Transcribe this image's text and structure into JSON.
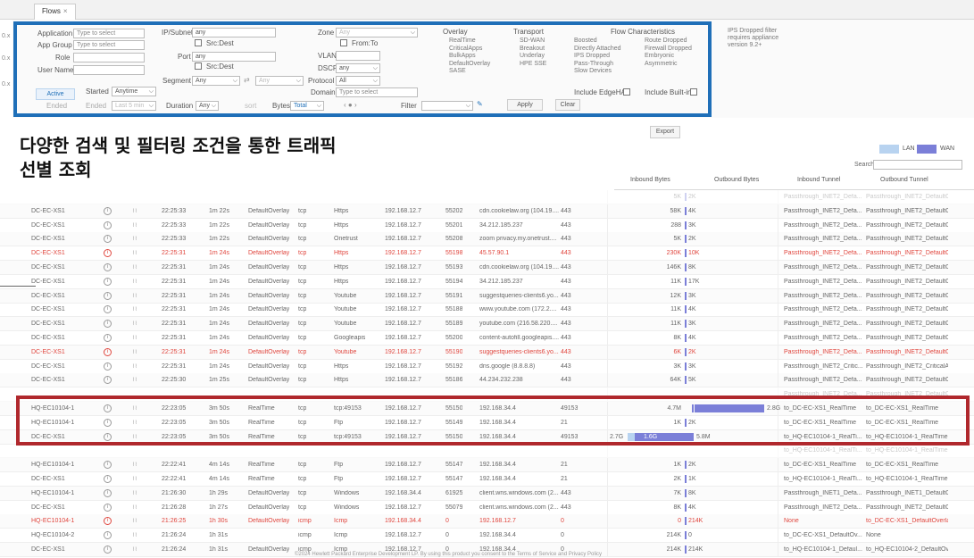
{
  "window": {
    "tab_label": "Flows",
    "tab_close": "×"
  },
  "left_ticks": [
    "0.x",
    "0.x",
    "0.x"
  ],
  "colors": {
    "lan": "#b8d3f0",
    "wan": "#7b7fd8",
    "frame_blue": "#1f6fb8",
    "frame_red": "#b0282d",
    "dropped_red": "#e0463e"
  },
  "filters": {
    "application_label": "Application",
    "application_placeholder": "Type to select",
    "app_group_label": "App Group",
    "app_group_placeholder": "Type to select",
    "role_label": "Role",
    "user_name_label": "User Name",
    "ip_subnet_label": "IP/Subnet",
    "ip_subnet_value": "any",
    "src_dest_1": "Src:Dest",
    "port_label": "Port",
    "port_value": "any",
    "src_dest_2": "Src:Dest",
    "segment_label": "Segment",
    "segment_value": "Any",
    "segment_value_2": "Any",
    "zone_label": "Zone",
    "zone_value": "Any",
    "from_to": "From:To",
    "vlan_label": "VLAN",
    "dscp_label": "DSCP",
    "dscp_value": "any",
    "protocol_label": "Protocol",
    "protocol_value": "All",
    "domain_label": "Domain",
    "domain_placeholder": "Type to select",
    "active_button": "Active",
    "ended_label": "Ended",
    "started_label": "Started",
    "started_value": "Anytime",
    "ended2_label": "Ended",
    "ended2_value": "Last 5 min",
    "duration_label": "Duration",
    "duration_value": "Any",
    "sort_label": "sort",
    "bytes_label": "Bytes",
    "bytes_value": "Total",
    "filter_label": "Filter",
    "apply_button": "Apply",
    "clear_button": "Clear"
  },
  "overlay": {
    "title": "Overlay",
    "options": [
      "RealTime",
      "CriticalApps",
      "BulkApps",
      "DefaultOverlay",
      "SASE"
    ]
  },
  "transport": {
    "title": "Transport",
    "options": [
      "SD-WAN",
      "Breakout",
      "Underlay",
      "HPE SSE"
    ]
  },
  "flow_characteristics": {
    "title": "Flow Characteristics",
    "col1": [
      "Boosted",
      "Directly Attached",
      "IPS Dropped",
      "Pass-Through",
      "Slow Devices"
    ],
    "col2": [
      "Route Dropped",
      "Firewall Dropped",
      "Embryonic",
      "Asymmetric"
    ],
    "include_edgeha": "Include EdgeHA",
    "include_builtin": "Include Built-in"
  },
  "ips_note": {
    "line1": "IPS Dropped filter",
    "line2": "requires appliance",
    "line3": "version 9.2+"
  },
  "heading": {
    "line1": "다양한 검색 및 필터링 조건을 통한 트래픽",
    "line2": "선별 조회"
  },
  "toolbar": {
    "export": "Export",
    "lan": "LAN",
    "wan": "WAN",
    "search_label": "Search"
  },
  "columns": {
    "inbound_bytes": "Inbound Bytes",
    "outbound_bytes": "Outbound Bytes",
    "inbound_tunnel": "Inbound Tunnel",
    "outbound_tunnel": "Outbound Tunnel"
  },
  "rows": [
    {
      "in": "5K",
      "out": "2K",
      "it": "Passthrough_INET2_Defa...",
      "ot": "Passthrough_INET2_DefaultOv...",
      "cut": true
    },
    {
      "dev": "DC-EC-XS1",
      "time": "22:25:33",
      "dur": "1m 22s",
      "ov": "DefaultOverlay",
      "proto": "tcp",
      "app": "Https",
      "src": "192.168.12.7",
      "sport": "55202",
      "dst": "cdn.cookielaw.org (104.19....",
      "dport": "443",
      "in": "58K",
      "out": "4K",
      "it": "Passthrough_INET2_Defa...",
      "ot": "Passthrough_INET2_DefaultOv..."
    },
    {
      "dev": "DC-EC-XS1",
      "time": "22:25:33",
      "dur": "1m 22s",
      "ov": "DefaultOverlay",
      "proto": "tcp",
      "app": "Https",
      "src": "192.168.12.7",
      "sport": "55201",
      "dst": "34.212.185.237",
      "dport": "443",
      "in": "288",
      "out": "3K",
      "it": "Passthrough_INET2_Defa...",
      "ot": "Passthrough_INET2_DefaultOv..."
    },
    {
      "dev": "DC-EC-XS1",
      "time": "22:25:33",
      "dur": "1m 22s",
      "ov": "DefaultOverlay",
      "proto": "tcp",
      "app": "Onetrust",
      "src": "192.168.12.7",
      "sport": "55208",
      "dst": "zoom privacy.my.onetrust....",
      "dport": "443",
      "in": "5K",
      "out": "2K",
      "it": "Passthrough_INET2_Defa...",
      "ot": "Passthrough_INET2_DefaultOv..."
    },
    {
      "dev": "DC-EC-XS1",
      "time": "22:25:31",
      "dur": "1m 24s",
      "ov": "DefaultOverlay",
      "proto": "tcp",
      "app": "Https",
      "src": "192.168.12.7",
      "sport": "55198",
      "dst": "45.57.90.1",
      "dport": "443",
      "in": "230K",
      "out": "10K",
      "it": "Passthrough_INET2_Defa...",
      "ot": "Passthrough_INET2_DefaultOv...",
      "red": true
    },
    {
      "dev": "DC-EC-XS1",
      "time": "22:25:31",
      "dur": "1m 24s",
      "ov": "DefaultOverlay",
      "proto": "tcp",
      "app": "Https",
      "src": "192.168.12.7",
      "sport": "55193",
      "dst": "cdn.cookielaw.org (104.19....",
      "dport": "443",
      "in": "146K",
      "out": "8K",
      "it": "Passthrough_INET2_Defa...",
      "ot": "Passthrough_INET2_DefaultOv..."
    },
    {
      "dev": "DC-EC-XS1",
      "time": "22:25:31",
      "dur": "1m 24s",
      "ov": "DefaultOverlay",
      "proto": "tcp",
      "app": "Https",
      "src": "192.168.12.7",
      "sport": "55194",
      "dst": "34.212.185.237",
      "dport": "443",
      "in": "11K",
      "out": "17K",
      "it": "Passthrough_INET2_Defa...",
      "ot": "Passthrough_INET2_DefaultOv..."
    },
    {
      "dev": "DC-EC-XS1",
      "time": "22:25:31",
      "dur": "1m 24s",
      "ov": "DefaultOverlay",
      "proto": "tcp",
      "app": "Youtube",
      "src": "192.168.12.7",
      "sport": "55191",
      "dst": "suggestqueries-clients6.yo...",
      "dport": "443",
      "in": "12K",
      "out": "3K",
      "it": "Passthrough_INET2_Defa...",
      "ot": "Passthrough_INET2_DefaultOv..."
    },
    {
      "dev": "DC-EC-XS1",
      "time": "22:25:31",
      "dur": "1m 24s",
      "ov": "DefaultOverlay",
      "proto": "tcp",
      "app": "Youtube",
      "src": "192.168.12.7",
      "sport": "55188",
      "dst": "www.youtube.com (172.2....",
      "dport": "443",
      "in": "11K",
      "out": "4K",
      "it": "Passthrough_INET2_Defa...",
      "ot": "Passthrough_INET2_DefaultOv..."
    },
    {
      "dev": "DC-EC-XS1",
      "time": "22:25:31",
      "dur": "1m 24s",
      "ov": "DefaultOverlay",
      "proto": "tcp",
      "app": "Youtube",
      "src": "192.168.12.7",
      "sport": "55189",
      "dst": "youtube.com (216.58.220....",
      "dport": "443",
      "in": "11K",
      "out": "3K",
      "it": "Passthrough_INET2_Defa...",
      "ot": "Passthrough_INET2_DefaultOv..."
    },
    {
      "dev": "DC-EC-XS1",
      "time": "22:25:31",
      "dur": "1m 24s",
      "ov": "DefaultOverlay",
      "proto": "tcp",
      "app": "Googleapis",
      "src": "192.168.12.7",
      "sport": "55200",
      "dst": "content-autofill.googleapis....",
      "dport": "443",
      "in": "8K",
      "out": "4K",
      "it": "Passthrough_INET2_Defa...",
      "ot": "Passthrough_INET2_DefaultOv..."
    },
    {
      "dev": "DC-EC-XS1",
      "time": "22:25:31",
      "dur": "1m 24s",
      "ov": "DefaultOverlay",
      "proto": "tcp",
      "app": "Youtube",
      "src": "192.168.12.7",
      "sport": "55190",
      "dst": "suggestqueries-clients6.yo...",
      "dport": "443",
      "in": "6K",
      "out": "2K",
      "it": "Passthrough_INET2_Defa...",
      "ot": "Passthrough_INET2_DefaultOv...",
      "red": true
    },
    {
      "dev": "DC-EC-XS1",
      "time": "22:25:31",
      "dur": "1m 24s",
      "ov": "DefaultOverlay",
      "proto": "tcp",
      "app": "Https",
      "src": "192.168.12.7",
      "sport": "55192",
      "dst": "dns.google (8.8.8.8)",
      "dport": "443",
      "in": "3K",
      "out": "3K",
      "it": "Passthrough_INET2_Critic...",
      "ot": "Passthrough_INET2_CriticalAp..."
    },
    {
      "dev": "DC-EC-XS1",
      "time": "22:25:30",
      "dur": "1m 25s",
      "ov": "DefaultOverlay",
      "proto": "tcp",
      "app": "Https",
      "src": "192.168.12.7",
      "sport": "55186",
      "dst": "44.234.232.238",
      "dport": "443",
      "in": "64K",
      "out": "5K",
      "it": "Passthrough_INET2_Defa...",
      "ot": "Passthrough_INET2_DefaultOv..."
    },
    {
      "cut": true,
      "it": "Passthrough_INET2_Defa...",
      "ot": "Passthrough_INET2_DefaultOv..."
    },
    {
      "dev": "HQ-EC10104-1",
      "time": "22:23:05",
      "dur": "3m 50s",
      "ov": "RealTime",
      "proto": "tcp",
      "app": "tcp:49153",
      "src": "192.168.12.7",
      "sport": "55150",
      "dst": "192.168.34.4",
      "dport": "49153",
      "in": "4.7M",
      "out": "2.8G",
      "it": "to_DC-EC-XS1_RealTime",
      "ot": "to_DC-EC-XS1_RealTime",
      "bar": "wan"
    },
    {
      "dev": "HQ-EC10104-1",
      "time": "22:23:05",
      "dur": "3m 50s",
      "ov": "RealTime",
      "proto": "tcp",
      "app": "Ftp",
      "src": "192.168.12.7",
      "sport": "55149",
      "dst": "192.168.34.4",
      "dport": "21",
      "in": "1K",
      "out": "2K",
      "it": "to_DC-EC-XS1_RealTime",
      "ot": "to_DC-EC-XS1_RealTime"
    },
    {
      "dev": "DC-EC-XS1",
      "time": "22:23:05",
      "dur": "3m 50s",
      "ov": "RealTime",
      "proto": "tcp",
      "app": "tcp:49153",
      "src": "192.168.12.7",
      "sport": "55150",
      "dst": "192.168.34.4",
      "dport": "49153",
      "in": "1.6G",
      "pre": "2.7G",
      "out": "5.8M",
      "it": "to_HQ-EC10104-1_RealTi...",
      "ot": "to_HQ-EC10104-1_RealTime",
      "bar": "mix"
    },
    {
      "cut": true,
      "it": "to_HQ-EC10104-1_RealTi...",
      "ot": "to_HQ-EC10104-1_RealTime"
    },
    {
      "dev": "HQ-EC10104-1",
      "time": "22:22:41",
      "dur": "4m 14s",
      "ov": "RealTime",
      "proto": "tcp",
      "app": "Ftp",
      "src": "192.168.12.7",
      "sport": "55147",
      "dst": "192.168.34.4",
      "dport": "21",
      "in": "1K",
      "out": "2K",
      "it": "to_DC-EC-XS1_RealTime",
      "ot": "to_DC-EC-XS1_RealTime"
    },
    {
      "dev": "DC-EC-XS1",
      "time": "22:22:41",
      "dur": "4m 14s",
      "ov": "RealTime",
      "proto": "tcp",
      "app": "Ftp",
      "src": "192.168.12.7",
      "sport": "55147",
      "dst": "192.168.34.4",
      "dport": "21",
      "in": "2K",
      "out": "1K",
      "it": "to_HQ-EC10104-1_RealTi...",
      "ot": "to_HQ-EC10104-1_RealTime"
    },
    {
      "dev": "HQ-EC10104-1",
      "time": "21:26:30",
      "dur": "1h 29s",
      "ov": "DefaultOverlay",
      "proto": "tcp",
      "app": "Windows",
      "src": "192.168.34.4",
      "sport": "61925",
      "dst": "client.wns.windows.com (2...",
      "dport": "443",
      "in": "7K",
      "out": "8K",
      "it": "Passthrough_INET1_Defa...",
      "ot": "Passthrough_INET1_DefaultOv..."
    },
    {
      "dev": "DC-EC-XS1",
      "time": "21:26:28",
      "dur": "1h 27s",
      "ov": "DefaultOverlay",
      "proto": "tcp",
      "app": "Windows",
      "src": "192.168.12.7",
      "sport": "55079",
      "dst": "client.wns.windows.com (2...",
      "dport": "443",
      "in": "8K",
      "out": "4K",
      "it": "Passthrough_INET2_Defa...",
      "ot": "Passthrough_INET2_DefaultOv..."
    },
    {
      "dev": "HQ-EC10104-1",
      "time": "21:26:25",
      "dur": "1h 30s",
      "ov": "DefaultOverlay",
      "proto": "icmp",
      "app": "Icmp",
      "src": "192.168.34.4",
      "sport": "0",
      "dst": "192.168.12.7",
      "dport": "0",
      "in": "0",
      "out": "214K",
      "it": "None",
      "ot": "to_DC-EC-XS1_DefaultOverlay",
      "red": true
    },
    {
      "dev": "HQ-EC10104-2",
      "time": "21:26:24",
      "dur": "1h 31s",
      "ov": "",
      "proto": "icmp",
      "app": "Icmp",
      "src": "192.168.12.7",
      "sport": "0",
      "dst": "192.168.34.4",
      "dport": "0",
      "in": "214K",
      "out": "0",
      "it": "to_DC-EC-XS1_DefaultOv...",
      "ot": "None"
    },
    {
      "dev": "DC-EC-XS1",
      "time": "21:26:24",
      "dur": "1h 31s",
      "ov": "DefaultOverlay",
      "proto": "icmp",
      "app": "Icmp",
      "src": "192.168.12.7",
      "sport": "0",
      "dst": "192.168.34.4",
      "dport": "0",
      "in": "214K",
      "out": "214K",
      "it": "to_HQ-EC10104-1_Defaul...",
      "ot": "to_HQ-EC10104-2_DefaultOve..."
    }
  ],
  "footer": "©2024 Hewlett Packard Enterprise Development LP. By using this product you consent to the Terms of Service and Privacy Policy"
}
